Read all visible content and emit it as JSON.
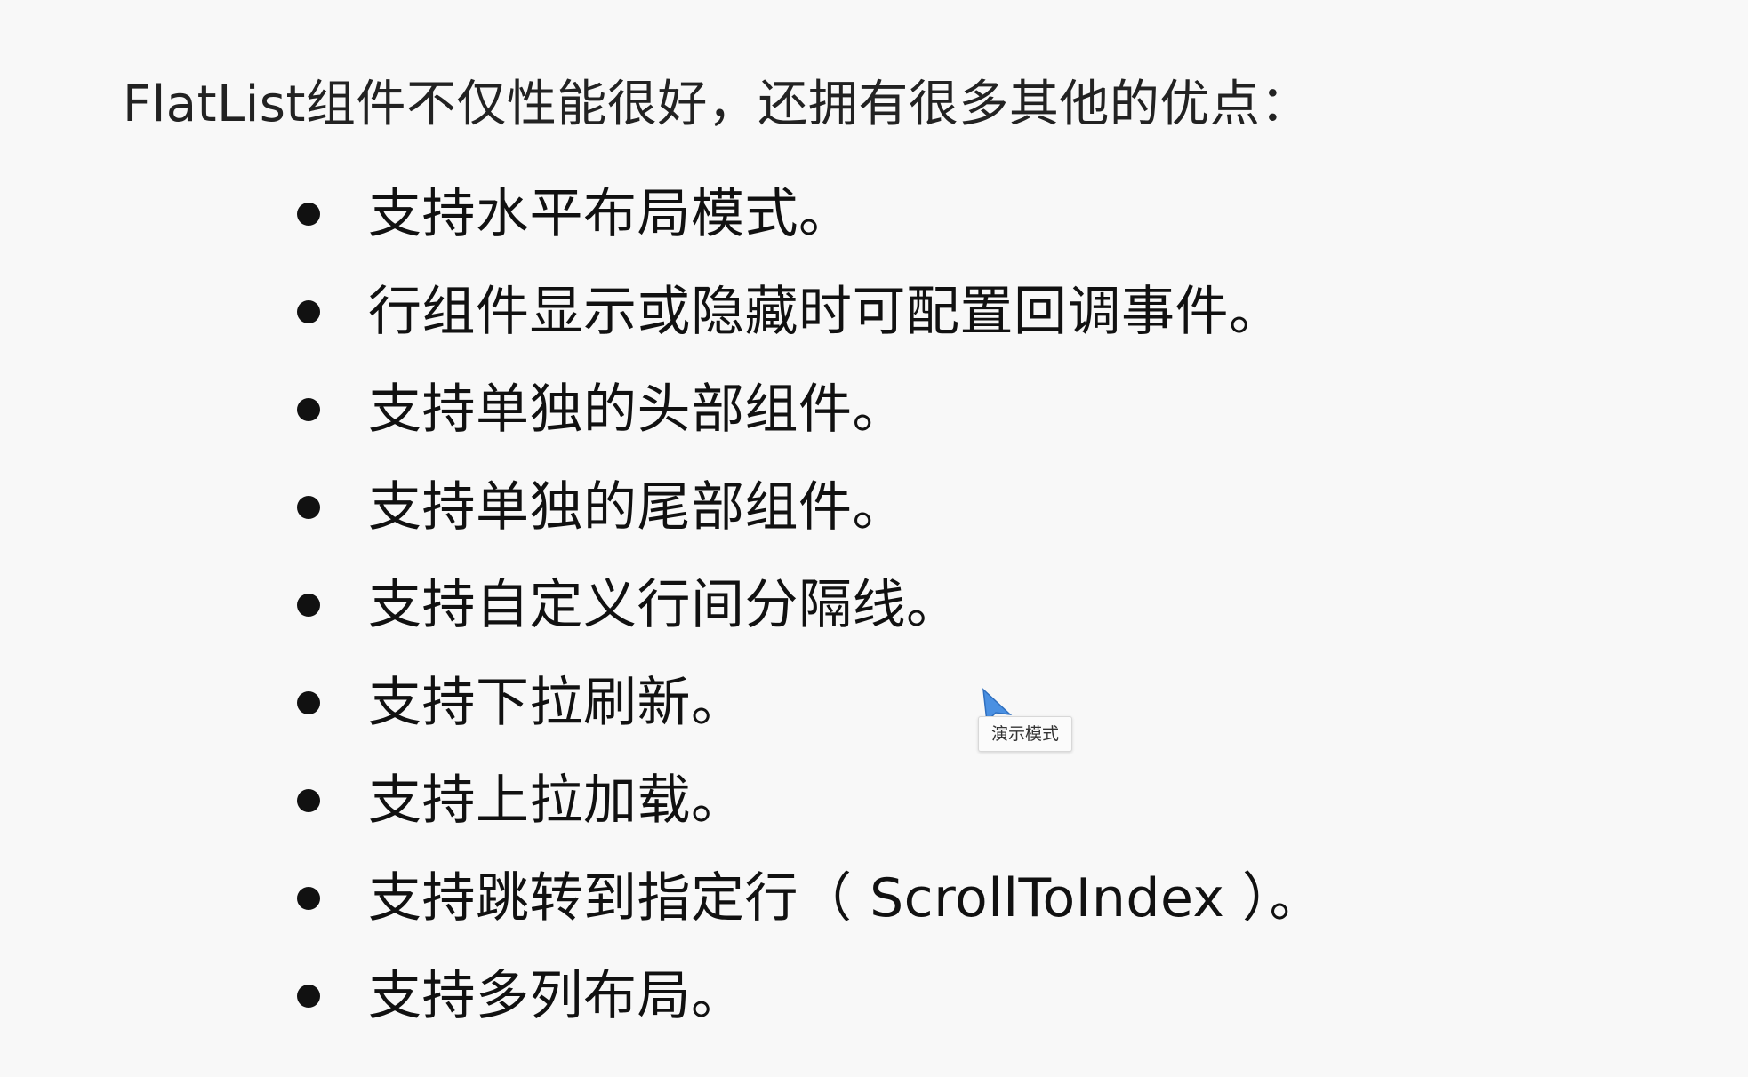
{
  "heading": "FlatList组件不仅性能很好，还拥有很多其他的优点：",
  "bullets": [
    "支持水平布局模式。",
    "行组件显示或隐藏时可配置回调事件。",
    "支持单独的头部组件。",
    "支持单独的尾部组件。",
    "支持自定义行间分隔线。",
    "支持下拉刷新。",
    "支持上拉加载。",
    "支持跳转到指定行（ ScrollToIndex ）。",
    "支持多列布局。"
  ],
  "cursor_tooltip": "演示模式",
  "colors": {
    "background": "#f8f8f8",
    "text": "#111111",
    "cursor": "#4a90e2"
  },
  "icons": {
    "cursor": "pointer-arrow-icon",
    "bullet": "bullet-dot-icon"
  }
}
